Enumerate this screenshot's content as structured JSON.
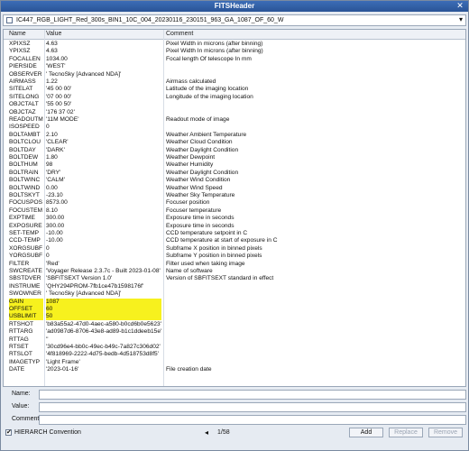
{
  "window": {
    "title": "FITSHeader",
    "close_glyph": "✕"
  },
  "file_selector": {
    "value": "IC447_RGB_LIGHT_Red_300s_BIN1_10C_004_20230116_230151_963_GA_1087_OF_60_W",
    "dropdown_glyph": "▾"
  },
  "table": {
    "columns": [
      "Name",
      "Value",
      "Comment"
    ],
    "rows": [
      {
        "name": "XPIXSZ",
        "value": "4.63",
        "comment": "Pixel Width in microns (after binning)"
      },
      {
        "name": "YPIXSZ",
        "value": "4.63",
        "comment": "Pixel Width In microns (after binning)"
      },
      {
        "name": "FOCALLEN",
        "value": "1034.00",
        "comment": "Focal length Of telescope In mm"
      },
      {
        "name": "PIERSIDE",
        "value": "'WEST'",
        "comment": ""
      },
      {
        "name": "OBSERVER",
        "value": "' TecnoSky [Advanced NDA]'",
        "comment": ""
      },
      {
        "name": "AIRMASS",
        "value": "1.22",
        "comment": "Airmass calculated"
      },
      {
        "name": "SITELAT",
        "value": "'45 00 00'",
        "comment": "Latitude of the imaging location"
      },
      {
        "name": "SITELONG",
        "value": "'07 00 00'",
        "comment": "Longitude of the imaging location"
      },
      {
        "name": "OBJCTALT",
        "value": "'55 00 50'",
        "comment": ""
      },
      {
        "name": "OBJCTAZ",
        "value": "'176 37 02'",
        "comment": ""
      },
      {
        "name": "READOUTM",
        "value": "'11M MODE'",
        "comment": "Readout mode of image"
      },
      {
        "name": "ISOSPEED",
        "value": "0",
        "comment": ""
      },
      {
        "name": "BOLTAMBT",
        "value": "2.10",
        "comment": "Weather Ambient Temperature"
      },
      {
        "name": "BOLTCLOU",
        "value": "'CLEAR'",
        "comment": "Weather Cloud Condition"
      },
      {
        "name": "BOLTDAY",
        "value": "'DARK'",
        "comment": "Weather Daylight Condition"
      },
      {
        "name": "BOLTDEW",
        "value": "1.80",
        "comment": "Weather Dewpoint"
      },
      {
        "name": "BOLTHUM",
        "value": "98",
        "comment": "Weather Humidity"
      },
      {
        "name": "BOLTRAIN",
        "value": "'DRY'",
        "comment": "Weather Daylight Condition"
      },
      {
        "name": "BOLTWINC",
        "value": "'CALM'",
        "comment": "Weather Wind Condition"
      },
      {
        "name": "BOLTWIND",
        "value": "0.00",
        "comment": "Weather Wind Speed"
      },
      {
        "name": "BOLTSKYT",
        "value": "-23.10",
        "comment": "Weather Sky Temperature"
      },
      {
        "name": "FOCUSPOS",
        "value": "8573.00",
        "comment": "Focuser position"
      },
      {
        "name": "FOCUSTEM",
        "value": "8.10",
        "comment": "Focuser temperature"
      },
      {
        "name": "EXPTIME",
        "value": "300.00",
        "comment": "Exposure time in seconds"
      },
      {
        "name": "EXPOSURE",
        "value": "300.00",
        "comment": "Exposure time in seconds"
      },
      {
        "name": "SET-TEMP",
        "value": "-10.00",
        "comment": "CCD temperature setpoint in C"
      },
      {
        "name": "CCD-TEMP",
        "value": "-10.00",
        "comment": "CCD temperature at start of exposure in C"
      },
      {
        "name": "XORGSUBF",
        "value": "0",
        "comment": "Subframe X position in binned pixels"
      },
      {
        "name": "YORGSUBF",
        "value": "0",
        "comment": "Subframe Y position in binned pixels"
      },
      {
        "name": "FILTER",
        "value": "'Red'",
        "comment": "Filter used when taking image"
      },
      {
        "name": "SWCREATE",
        "value": "'Voyager Release 2.3.7c - Built 2023-01-08'",
        "comment": "Name of software"
      },
      {
        "name": "SBSTDVER",
        "value": "'SBFITSEXT Version 1.0'",
        "comment": "Version of SBFITSEXT standard in effect"
      },
      {
        "name": "INSTRUME",
        "value": "'QHY294PROM-7fb1ce47b1598176f'",
        "comment": ""
      },
      {
        "name": "SWOWNER",
        "value": "' TecnoSky [Advanced NDA]'",
        "comment": ""
      },
      {
        "name": "GAIN",
        "value": "1087",
        "comment": "",
        "highlight": true
      },
      {
        "name": "OFFSET",
        "value": "60",
        "comment": "",
        "highlight": true
      },
      {
        "name": "USBLIMIT",
        "value": "50",
        "comment": "",
        "highlight": true
      },
      {
        "name": "RTSHOT",
        "value": "'b83a55a2-47d0-4aec-a580-b0cd6b0e5623'",
        "comment": ""
      },
      {
        "name": "RTTARG",
        "value": "'ad0987d6-8706-43e8-ad89-b1c1ddeeb15e'",
        "comment": ""
      },
      {
        "name": "RTTAG",
        "value": "''",
        "comment": ""
      },
      {
        "name": "RTSET",
        "value": "'30cd96e4-bb0c-49ec-b49c-7a827c306d02'",
        "comment": ""
      },
      {
        "name": "RTSLOT",
        "value": "'4f818969-2222-4d75-bedb-4d518753d8f5'",
        "comment": ""
      },
      {
        "name": "IMAGETYP",
        "value": "'Light Frame'",
        "comment": ""
      },
      {
        "name": "DATE",
        "value": "'2023-01-16'",
        "comment": "File creation date"
      }
    ]
  },
  "form": {
    "name_label": "Name:",
    "value_label": "Value:",
    "comment_label": "Comment:"
  },
  "footer": {
    "hierarch_label": "HIERARCH Convention",
    "hierarch_checked": "✔",
    "prev_glyph": "◂",
    "pager": "1/58",
    "add_label": "Add",
    "replace_label": "Replace",
    "remove_label": "Remove"
  },
  "colors": {
    "highlight": "#f7f11e",
    "title_bar": "#2a5496"
  }
}
